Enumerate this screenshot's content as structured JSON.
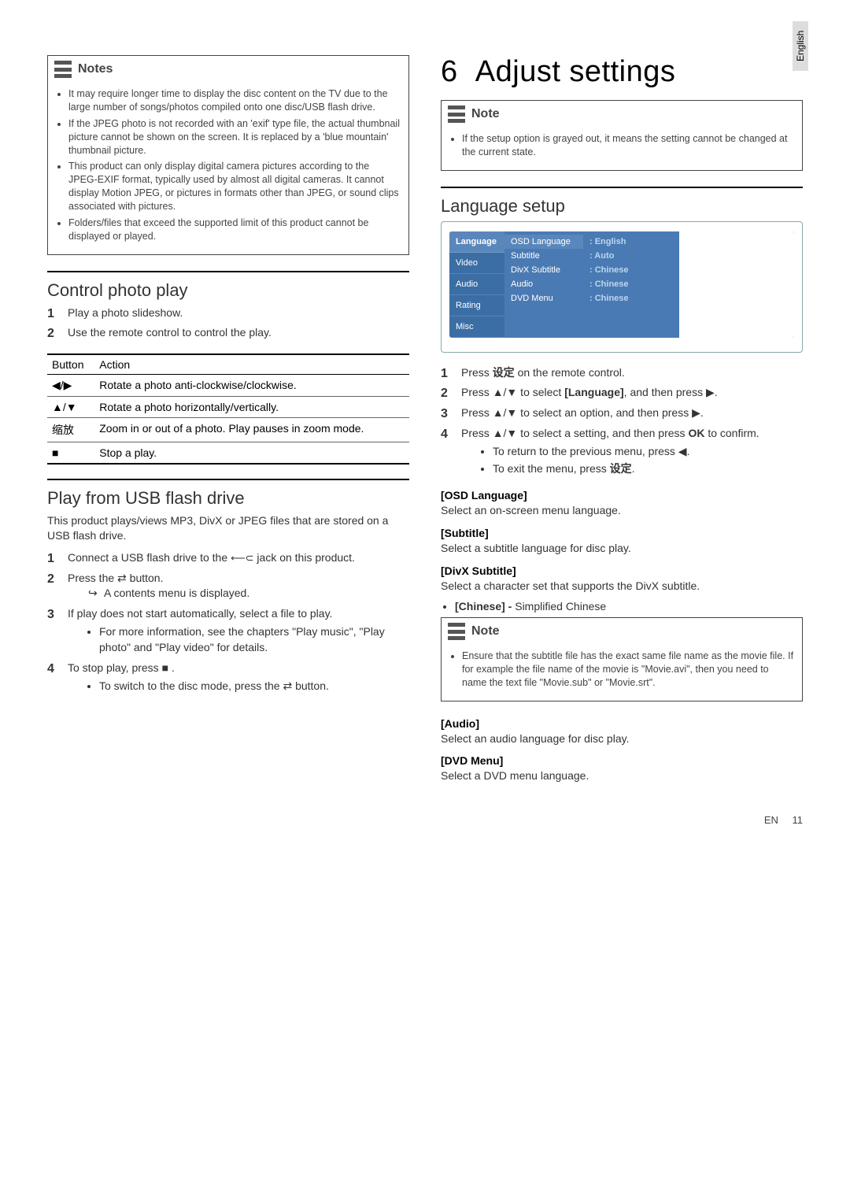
{
  "sideTab": "English",
  "left": {
    "notesTitle": "Notes",
    "notes": [
      "It may require longer time to display the disc content on the TV due to the large number of songs/photos compiled onto one disc/USB flash drive.",
      "If the JPEG photo is not recorded with an 'exif' type file, the actual thumbnail picture cannot be shown on the screen. It is replaced by a 'blue mountain' thumbnail picture.",
      "This product can only display digital camera pictures according to the JPEG-EXIF format, typically used by almost all digital cameras. It cannot display Motion JPEG, or pictures in formats other than JPEG, or sound clips associated with pictures.",
      "Folders/files that exceed the supported limit of this product cannot be displayed or played."
    ],
    "controlHeading": "Control photo play",
    "controlSteps": [
      "Play a photo slideshow.",
      "Use the remote control to control the play."
    ],
    "tableHead": {
      "c1": "Button",
      "c2": "Action"
    },
    "tableRows": [
      {
        "btn": "◀/▶",
        "act": "Rotate a photo anti-clockwise/clockwise."
      },
      {
        "btn": "▲/▼",
        "act": "Rotate a photo horizontally/vertically."
      },
      {
        "btn": "缩放",
        "act": "Zoom in or out of a photo. Play pauses in zoom mode."
      },
      {
        "btn": "■",
        "act": "Stop a play."
      }
    ],
    "usbHeading": "Play from USB flash drive",
    "usbIntro": "This product plays/views MP3, DivX or JPEG files that are stored on a USB flash drive.",
    "usbSteps": {
      "s1a": "Connect a USB flash drive to the ",
      "s1b": " jack on this product.",
      "s2a": "Press the ",
      "s2b": " button.",
      "s2sub": "A contents menu is displayed.",
      "s3": "If play does not start automatically, select a file to play.",
      "s3sub": "For more information, see the chapters \"Play music\", \"Play photo\" and \"Play video\" for details.",
      "s4a": "To stop play, press ",
      "s4b": " .",
      "s4suba": "To switch to the disc mode, press the ",
      "s4subb": " button."
    }
  },
  "right": {
    "chapterNum": "6",
    "chapterTitle": "Adjust settings",
    "noteTitle": "Note",
    "noteBody": "If the setup option is grayed out, it means the setting cannot be changed at the current state.",
    "langHeading": "Language setup",
    "setup": {
      "tabs": [
        "Language",
        "Video",
        "Audio",
        "Rating",
        "Misc"
      ],
      "keys": [
        "OSD Language",
        "Subtitle",
        "DivX Subtitle",
        "Audio",
        "DVD Menu"
      ],
      "vals": [
        ": English",
        ": Auto",
        ": Chinese",
        ": Chinese",
        ": Chinese"
      ]
    },
    "steps": {
      "s1a": "Press ",
      "s1key": "设定",
      "s1b": " on the remote control.",
      "s2a": "Press ",
      "s2key": " to select ",
      "s2bold": "[Language]",
      "s2b": ", and then press ",
      "s2c": ".",
      "s3a": "Press ",
      "s3b": " to select an option, and then press ",
      "s3c": ".",
      "s4a": "Press ",
      "s4b": " to select a setting, and then press ",
      "s4bold": "OK",
      "s4c": " to confirm.",
      "s4sub1a": "To return to the previous menu, press ",
      "s4sub1b": ".",
      "s4sub2a": "To exit the menu, press ",
      "s4sub2key": "设定",
      "s4sub2b": "."
    },
    "terms": {
      "osd": {
        "h": "[OSD Language]",
        "p": "Select an on-screen menu language."
      },
      "sub": {
        "h": "[Subtitle]",
        "p": "Select a subtitle language for disc play."
      },
      "divx": {
        "h": "[DivX Subtitle]",
        "p": "Select a character set that supports the DivX subtitle.",
        "li": "[Chinese] - ",
        "liTail": "Simplified Chinese"
      },
      "note2Title": "Note",
      "note2Body": "Ensure that the subtitle file has the exact same file name as the movie file. If for example the file name of the movie is \"Movie.avi\", then you need to name the text file \"Movie.sub\" or \"Movie.srt\".",
      "audio": {
        "h": "[Audio]",
        "p": "Select an audio language for disc play."
      },
      "dvd": {
        "h": "[DVD Menu]",
        "p": "Select a DVD menu language."
      }
    }
  },
  "footer": {
    "lang": "EN",
    "page": "11"
  }
}
